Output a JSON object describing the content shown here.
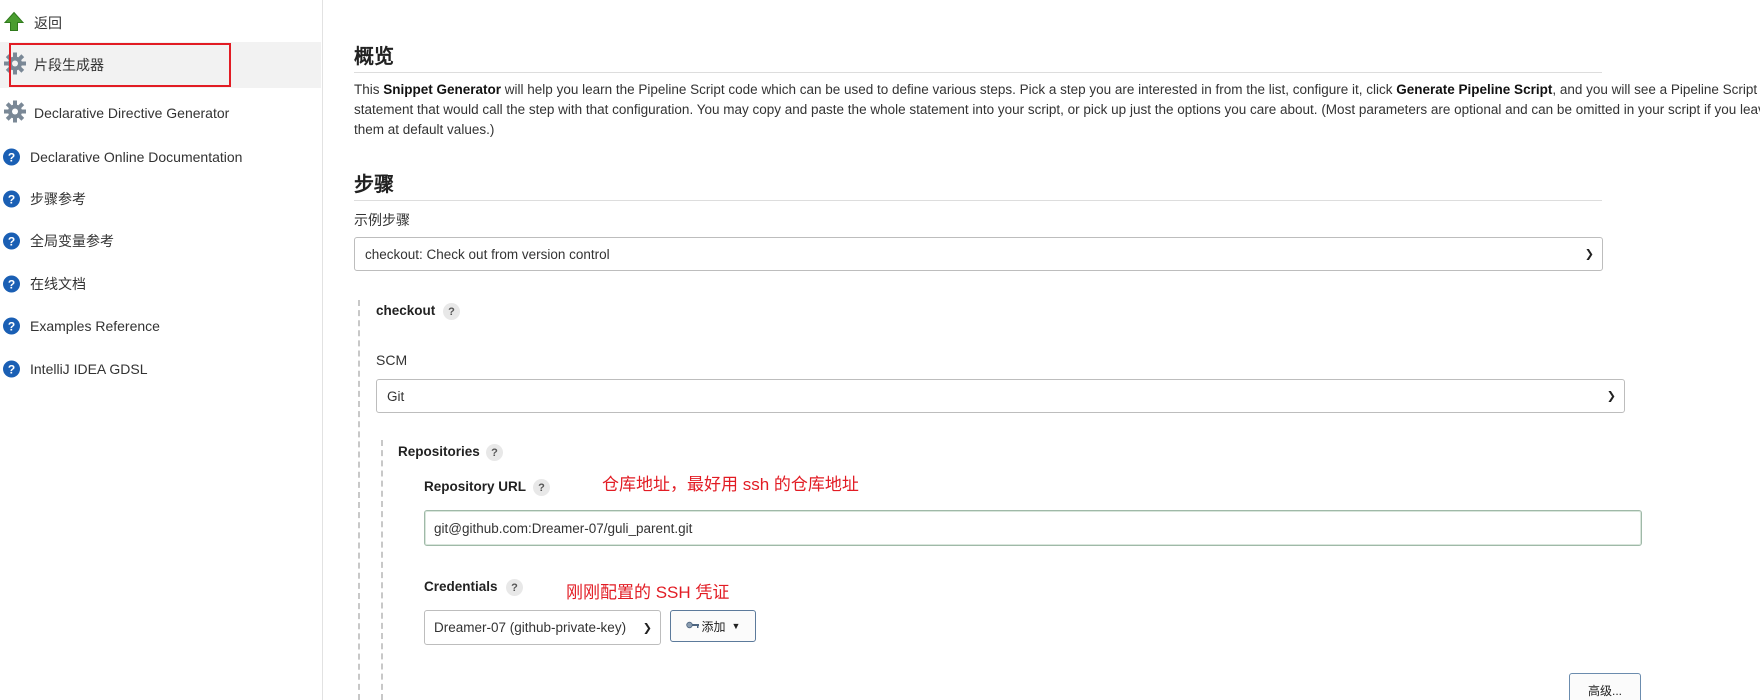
{
  "sidebar": {
    "items": [
      {
        "label": "返回",
        "icon": "green-up-arrow-icon"
      },
      {
        "label": "片段生成器",
        "icon": "gear-icon"
      },
      {
        "label": "Declarative Directive Generator",
        "icon": "gear-icon"
      },
      {
        "label": "Declarative Online Documentation",
        "icon": "help-icon"
      },
      {
        "label": "步骤参考",
        "icon": "help-icon"
      },
      {
        "label": "全局变量参考",
        "icon": "help-icon"
      },
      {
        "label": "在线文档",
        "icon": "help-icon"
      },
      {
        "label": "Examples Reference",
        "icon": "help-icon"
      },
      {
        "label": "IntelliJ IDEA GDSL",
        "icon": "help-icon"
      }
    ],
    "highlight_color": "#e21c24"
  },
  "overview": {
    "title": "概览",
    "text_1": "This ",
    "bold_1": "Snippet Generator",
    "text_2": " will help you learn the Pipeline Script code which can be used to define various steps. Pick a step you are interested in from the list, configure it, click ",
    "bold_2": "Generate Pipeline Script",
    "text_3": ", and you will see a Pipeline Script statement that would call the step with that configuration. You may copy and paste the whole statement into your script, or pick up just the options you care about. (Most parameters are optional and can be omitted in your script if you leave them at default values.)"
  },
  "steps": {
    "title": "步骤",
    "sample_label": "示例步骤",
    "sample_value": "checkout: Check out from version control"
  },
  "checkout": {
    "title": "checkout",
    "help": "?",
    "scm_label": "SCM",
    "scm_value": "Git"
  },
  "repositories": {
    "title": "Repositories",
    "help": "?",
    "url_label": "Repository URL",
    "url_value": "git@github.com:Dreamer-07/guli_parent.git",
    "url_annotation": "仓库地址，最好用 ssh 的仓库地址",
    "credentials_label": "Credentials",
    "credentials_value": "Dreamer-07 (github-private-key)",
    "credentials_annotation": "刚刚配置的 SSH 凭证",
    "add_button": "添加",
    "advanced_button": "高级..."
  }
}
